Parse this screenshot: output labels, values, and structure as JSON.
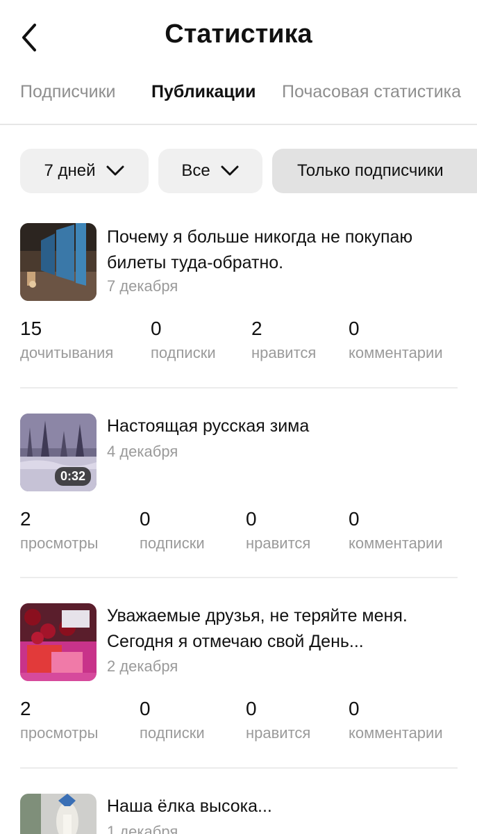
{
  "header": {
    "title": "Статистика"
  },
  "tabs": [
    {
      "label": "Подписчики",
      "active": false
    },
    {
      "label": "Публикации",
      "active": true
    },
    {
      "label": "Почасовая статистика",
      "active": false
    }
  ],
  "filters": {
    "period": "7 дней",
    "type": "Все",
    "subscribers_only": "Только подписчики"
  },
  "publications": [
    {
      "title": "Почему я больше никогда не покупаю билеты туда-обратно.",
      "date": "7 декабря",
      "stats": [
        {
          "value": "15",
          "label": "дочитывания"
        },
        {
          "value": "0",
          "label": "подписки"
        },
        {
          "value": "2",
          "label": "нравится"
        },
        {
          "value": "0",
          "label": "комментарии"
        }
      ]
    },
    {
      "title": "Настоящая русская зима",
      "date": "4 декабря",
      "duration": "0:32",
      "stats": [
        {
          "value": "2",
          "label": "просмотры"
        },
        {
          "value": "0",
          "label": "подписки"
        },
        {
          "value": "0",
          "label": "нравится"
        },
        {
          "value": "0",
          "label": "комментарии"
        }
      ]
    },
    {
      "title": "Уважаемые друзья, не теряйте меня. Сегодня я отмечаю свой День...",
      "date": "2 декабря",
      "stats": [
        {
          "value": "2",
          "label": "просмотры"
        },
        {
          "value": "0",
          "label": "подписки"
        },
        {
          "value": "0",
          "label": "нравится"
        },
        {
          "value": "0",
          "label": "комментарии"
        }
      ]
    },
    {
      "title": "Наша ёлка высока...",
      "date": "1 декабря"
    }
  ]
}
